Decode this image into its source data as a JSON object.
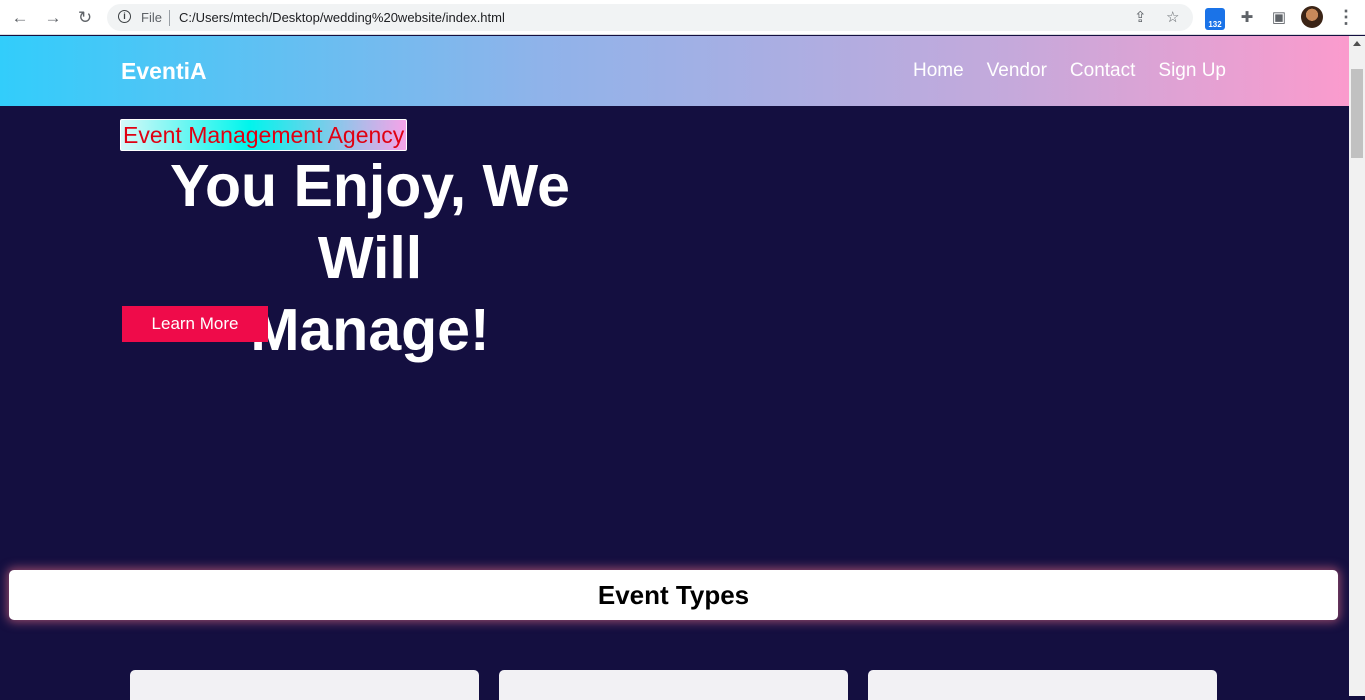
{
  "browser": {
    "file_label": "File",
    "url": "C:/Users/mtech/Desktop/wedding%20website/index.html",
    "extension_badge": "132",
    "icons": [
      "back-icon",
      "forward-icon",
      "reload-icon",
      "info-icon",
      "share-icon",
      "star-icon",
      "puzzle-icon",
      "side-panel-icon",
      "avatar",
      "kebab-menu-icon"
    ]
  },
  "header": {
    "brand": "EventiA",
    "nav": [
      "Home",
      "Vendor",
      "Contact",
      "Sign Up"
    ]
  },
  "hero": {
    "tagline": "Event Management Agency",
    "title_line1": "You Enjoy, We Will",
    "title_line2": "Manage!",
    "button_label": "Learn More"
  },
  "event_types": {
    "title": "Event Types"
  },
  "colors": {
    "page_bg": "#140f40",
    "button": "#ef0b4a",
    "tagline_text": "#e00012",
    "header_gradient_start": "#32cdfb",
    "header_gradient_end": "#fb9bcd"
  }
}
